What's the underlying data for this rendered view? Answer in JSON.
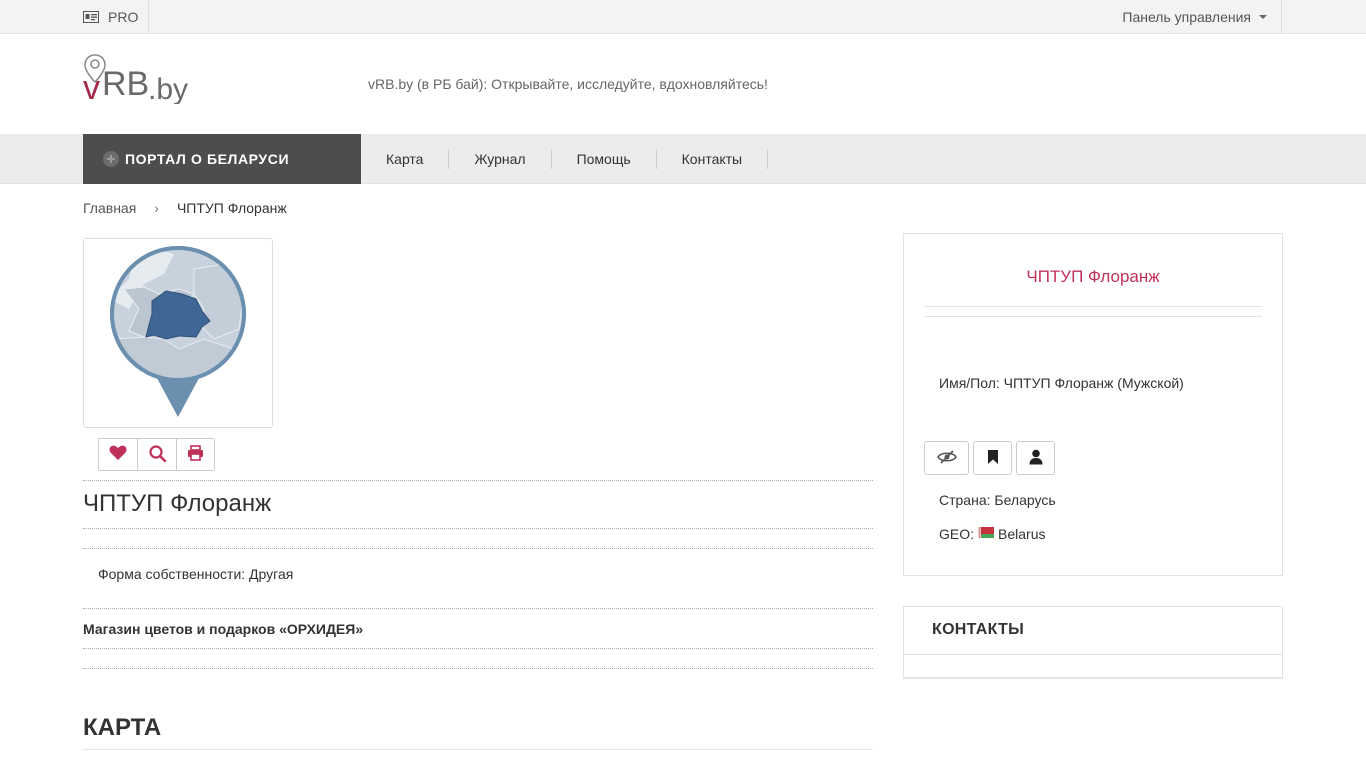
{
  "topbar": {
    "pro_label": "PRO",
    "panel_label": "Панель управления"
  },
  "header": {
    "logo_text_v": "v",
    "logo_text_rb": "RB",
    "logo_text_by": ".by",
    "tagline": "vRB.by (в РБ бай): Открывайте, исследуйте, вдохновляйтесь!"
  },
  "nav": {
    "portal_label": "ПОРТАЛ О БЕЛАРУСИ",
    "links": [
      {
        "label": "Карта"
      },
      {
        "label": "Журнал"
      },
      {
        "label": "Помощь"
      },
      {
        "label": "Контакты"
      }
    ]
  },
  "breadcrumb": {
    "home": "Главная",
    "separator": "›",
    "current": "ЧПТУП Флоранж"
  },
  "main": {
    "title": "ЧПТУП Флоранж",
    "forma": "Форма собственности: Другая",
    "shop": "Магазин цветов и подарков «ОРХИДЕЯ»",
    "map_heading": "КАРТА",
    "action_icons": [
      "heart-icon",
      "search-icon",
      "print-icon"
    ]
  },
  "card": {
    "name": "ЧПТУП Флоранж",
    "imya": "Имя/Пол: ЧПТУП Флоранж (Мужской)",
    "icons": [
      "eye-slash-icon",
      "bookmark-icon",
      "user-icon"
    ],
    "strana": "Страна: Беларусь",
    "geo_label": "GEO:",
    "geo_value": "Belarus"
  },
  "contacts": {
    "heading": "КОНТАКТЫ"
  },
  "colors": {
    "accent": "#c0315a",
    "nav_dark": "#4d4d4d",
    "map_blue": "#3f6795",
    "map_ring": "#6b8fae"
  }
}
